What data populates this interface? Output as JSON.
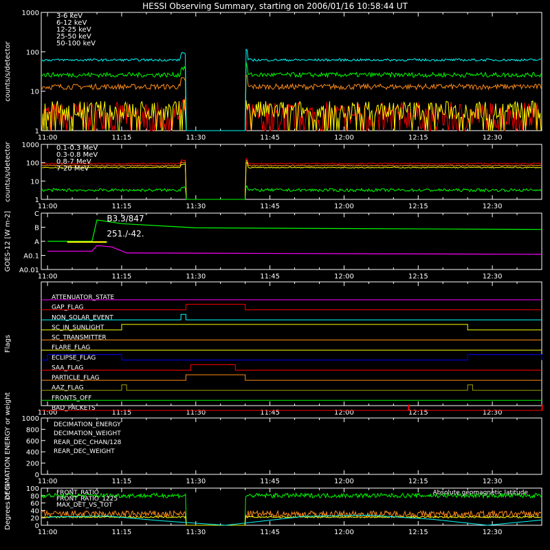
{
  "title": "HESSI Observing Summary, starting on 2006/01/16 10:58:44 UT",
  "time_ticks": [
    "11:00",
    "11:15",
    "11:30",
    "11:45",
    "12:00",
    "12:15",
    "12:30"
  ],
  "colors": {
    "red": "#ff0000",
    "orange": "#ff8c1a",
    "yellow": "#ffff00",
    "green": "#00ff00",
    "cyan": "#00ffff",
    "magenta": "#ff00ff",
    "blue": "#0000ff",
    "olive": "#a0a000",
    "white": "#ffffff"
  },
  "chart_data": [
    {
      "id": "lowE",
      "type": "line",
      "ylabel": "counts/s/detector",
      "yscale": "log",
      "ylim": [
        1,
        1000
      ],
      "yticks": [
        "1",
        "10",
        "100",
        "1000"
      ],
      "gap": [
        "11:28",
        "11:40"
      ],
      "series": [
        {
          "name": "3-6 keV",
          "color": "red",
          "level": 2.4,
          "noise": 0.35,
          "spiky": true
        },
        {
          "name": "6-12 keV",
          "color": "orange",
          "level": 13,
          "noise": 0.07
        },
        {
          "name": "12-25 keV",
          "color": "yellow",
          "level": 3.2,
          "noise": 0.25,
          "spiky": true
        },
        {
          "name": "25-50 keV",
          "color": "green",
          "level": 26,
          "noise": 0.06
        },
        {
          "name": "50-100 keV",
          "color": "cyan",
          "level": 62,
          "noise": 0.03
        }
      ]
    },
    {
      "id": "highE",
      "type": "line",
      "ylabel": "counts/s/detector",
      "yscale": "log",
      "ylim": [
        1,
        1000
      ],
      "yticks": [
        "1",
        "10",
        "100",
        "1000"
      ],
      "gap": [
        "11:28",
        "11:40"
      ],
      "series": [
        {
          "name": "0.1-0.3 MeV",
          "color": "red",
          "level": 90,
          "noise": 0.03
        },
        {
          "name": "0.3-0.8 MeV",
          "color": "orange",
          "level": 70,
          "noise": 0.03
        },
        {
          "name": "0.8-7 MeV",
          "color": "yellow",
          "level": 55,
          "noise": 0.03
        },
        {
          "name": "7-20 MeV",
          "color": "green",
          "level": 3.2,
          "noise": 0.08
        }
      ]
    },
    {
      "id": "goes",
      "type": "line",
      "ylabel": "GOES-12 [W m-2]",
      "yticks": [
        "A0.01",
        "A0.1",
        "A",
        "B",
        "C"
      ],
      "annotations": [
        "B3.3/847",
        "251./-42."
      ],
      "series": [
        {
          "name": "GOES long",
          "color": "green",
          "points": [
            [
              "11:00",
              "A"
            ],
            [
              "11:09",
              "A"
            ],
            [
              "11:10",
              "B3.3"
            ],
            [
              "11:15",
              "B1.8"
            ],
            [
              "11:30",
              "B0.9"
            ],
            [
              "12:00",
              "B0.8"
            ],
            [
              "12:40",
              "B0.7"
            ]
          ]
        },
        {
          "name": "GOES short",
          "color": "magenta",
          "points": [
            [
              "11:00",
              "A0.2"
            ],
            [
              "11:09",
              "A0.2"
            ],
            [
              "11:10",
              "A0.5"
            ],
            [
              "11:13",
              "A0.4"
            ],
            [
              "11:16",
              "A0.15"
            ],
            [
              "12:40",
              "A0.12"
            ]
          ]
        }
      ]
    },
    {
      "id": "flags",
      "type": "table",
      "ylabel": "Flags",
      "rows": [
        {
          "name": "ATTENUATOR_STATE",
          "color": "magenta",
          "on": []
        },
        {
          "name": "GAP_FLAG",
          "color": "red",
          "on": [
            [
              "11:28",
              "11:40"
            ]
          ]
        },
        {
          "name": "NON_SOLAR_EVENT",
          "color": "cyan",
          "on": [
            [
              "11:27",
              "11:28"
            ]
          ]
        },
        {
          "name": "SC_IN_SUNLIGHT",
          "color": "yellow",
          "on": [
            [
              "11:15",
              "12:25"
            ]
          ]
        },
        {
          "name": "SC_TRANSMITTER",
          "color": "orange",
          "on": []
        },
        {
          "name": "FLARE_FLAG",
          "color": "yellow",
          "on": []
        },
        {
          "name": "ECLIPSE_FLAG",
          "color": "blue",
          "on": [
            [
              "11:00",
              "11:15"
            ],
            [
              "12:25",
              "12:40"
            ]
          ]
        },
        {
          "name": "SAA_FLAG",
          "color": "red",
          "on": [
            [
              "11:29",
              "11:38"
            ]
          ]
        },
        {
          "name": "PARTICLE_FLAG",
          "color": "orange",
          "on": [
            [
              "11:28",
              "11:40"
            ]
          ]
        },
        {
          "name": "AAZ_FLAG",
          "color": "olive",
          "on": [
            [
              "11:15",
              "11:16"
            ],
            [
              "12:25",
              "12:26"
            ]
          ]
        },
        {
          "name": "FRONTS_OFF",
          "color": "green",
          "on": []
        },
        {
          "name": "BAD_PACKETS",
          "color": "red",
          "on": [
            [
              "12:13",
              "12:13"
            ],
            [
              "12:40",
              "12:40"
            ]
          ]
        }
      ]
    },
    {
      "id": "decim",
      "type": "line",
      "ylabel": "DECIMATION ENERGY or weight",
      "yticks": [
        "0",
        "200",
        "400",
        "600",
        "800",
        "1000"
      ],
      "ylim": [
        0,
        1000
      ],
      "series": [
        {
          "name": "DECIMATION_ENERGY",
          "color": "green"
        },
        {
          "name": "DECIMATION_WEIGHT",
          "color": "orange"
        },
        {
          "name": "REAR_DEC_CHAN/128",
          "color": "cyan"
        },
        {
          "name": "REAR_DEC_WEIGHT",
          "color": "olive"
        }
      ]
    },
    {
      "id": "ratio",
      "type": "line",
      "ylabel": "Degrees or %",
      "yticks": [
        "0",
        "20",
        "40",
        "60",
        "80",
        "100"
      ],
      "ylim": [
        0,
        100
      ],
      "gap": [
        "11:28",
        "11:40"
      ],
      "series": [
        {
          "name": "FRONT_RATIO",
          "color": "green",
          "level": 80,
          "noise": 6
        },
        {
          "name": "FRONT_RATIO_1225",
          "color": "orange",
          "level": 30,
          "noise": 9
        },
        {
          "name": "MAX_DET_VS_TOT",
          "color": "yellow",
          "level": 22,
          "noise": 2
        },
        {
          "name": "Absolute geomagnetic latitude",
          "color": "cyan",
          "points": [
            [
              "11:00",
              22
            ],
            [
              "11:12",
              25
            ],
            [
              "11:23",
              12
            ],
            [
              "11:36",
              0
            ],
            [
              "11:52",
              24
            ],
            [
              "12:05",
              27
            ],
            [
              "12:18",
              16
            ],
            [
              "12:29",
              0
            ],
            [
              "12:40",
              14
            ]
          ]
        }
      ]
    }
  ]
}
